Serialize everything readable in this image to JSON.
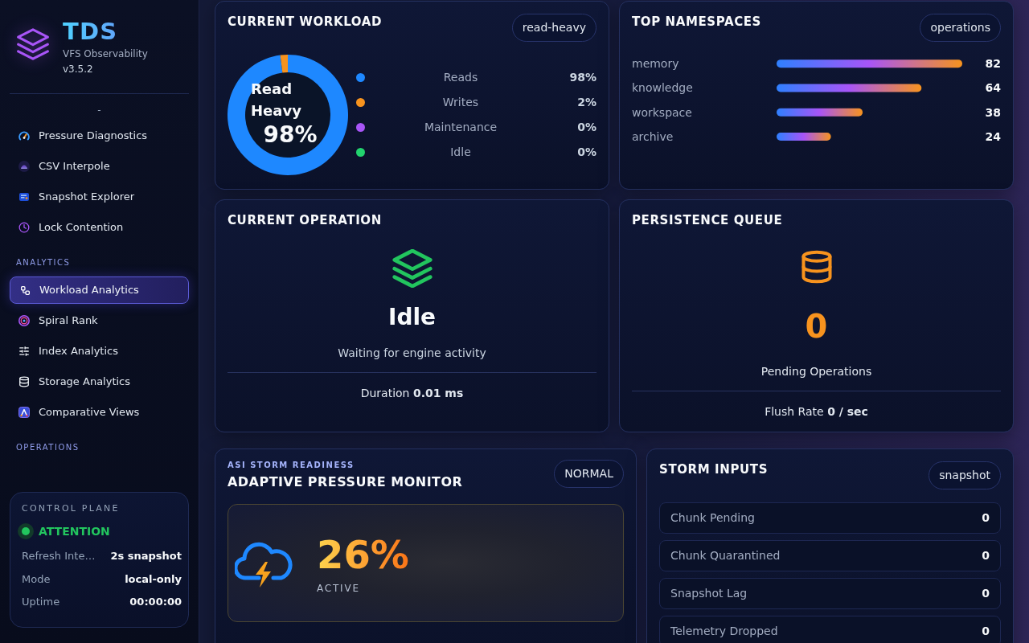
{
  "sidebar": {
    "brand": {
      "name": "TDS",
      "subtitle": "VFS Observability",
      "version": "v3.5.2"
    },
    "top_label": "-",
    "items": [
      {
        "label": "Pressure Diagnostics",
        "selected": false
      },
      {
        "label": "CSV Interpole",
        "selected": false
      },
      {
        "label": "Snapshot Explorer",
        "selected": false
      },
      {
        "label": "Lock Contention",
        "selected": false
      }
    ],
    "sections": [
      {
        "title": "ANALYTICS",
        "items": [
          {
            "label": "Workload Analytics",
            "selected": true
          },
          {
            "label": "Spiral Rank",
            "selected": false
          },
          {
            "label": "Index Analytics",
            "selected": false
          },
          {
            "label": "Storage Analytics",
            "selected": false
          },
          {
            "label": "Comparative Views",
            "selected": false
          }
        ]
      },
      {
        "title": "OPERATIONS"
      }
    ],
    "control_plane": {
      "title": "CONTROL PLANE",
      "status": "ATTENTION",
      "rows": [
        {
          "label": "Refresh Inte…",
          "value": "2s snapshot"
        },
        {
          "label": "Mode",
          "value": "local-only"
        },
        {
          "label": "Uptime",
          "value": "00:00:00"
        }
      ]
    }
  },
  "workload": {
    "title": "CURRENT WORKLOAD",
    "badge": "read-heavy",
    "center_label": "Read Heavy",
    "center_value": "98%",
    "legend": [
      {
        "value": "98%",
        "color": "#1e88ff"
      },
      {
        "value": "2%",
        "color": "#f7931e"
      },
      {
        "value": "0%",
        "color": "#a855f7"
      },
      {
        "value": "0%",
        "color": "#22d36e"
      }
    ],
    "chart_data": {
      "type": "donut",
      "categories": [
        "Reads",
        "Writes",
        "Maintenance",
        "Idle"
      ],
      "values": [
        98,
        2,
        0,
        0
      ]
    }
  },
  "namespaces": {
    "title": "TOP NAMESPACES",
    "badge": "operations",
    "chart_data": {
      "type": "bar",
      "orientation": "horizontal",
      "categories": [
        "memory",
        "knowledge",
        "workspace",
        "archive"
      ],
      "values": [
        82,
        64,
        38,
        24
      ],
      "value_labels": [
        "82",
        "64",
        "38",
        "24"
      ]
    }
  },
  "operation": {
    "title": "CURRENT OPERATION",
    "state": "Idle",
    "message": "Waiting for engine activity",
    "duration": "Duration **0.01 ms**"
  },
  "persistence_queue": {
    "title": "PERSISTENCE QUEUE",
    "count": "0",
    "count_label": "Pending Operations",
    "flush_rate": "Flush Rate **0 / sec**"
  },
  "pressure_monitor": {
    "eyebrow": "ASI STORM READINESS",
    "title": "ADAPTIVE PRESSURE MONITOR",
    "badge": "NORMAL",
    "value": "26%",
    "status": "ACTIVE"
  },
  "storm_inputs": {
    "title": "STORM INPUTS",
    "badge": "snapshot",
    "rows": [
      {
        "label": "Chunk Pending",
        "value": "0"
      },
      {
        "label": "Chunk Quarantined",
        "value": "0"
      },
      {
        "label": "Snapshot Lag",
        "value": "0"
      },
      {
        "label": "Telemetry Dropped",
        "value": "0"
      }
    ]
  }
}
